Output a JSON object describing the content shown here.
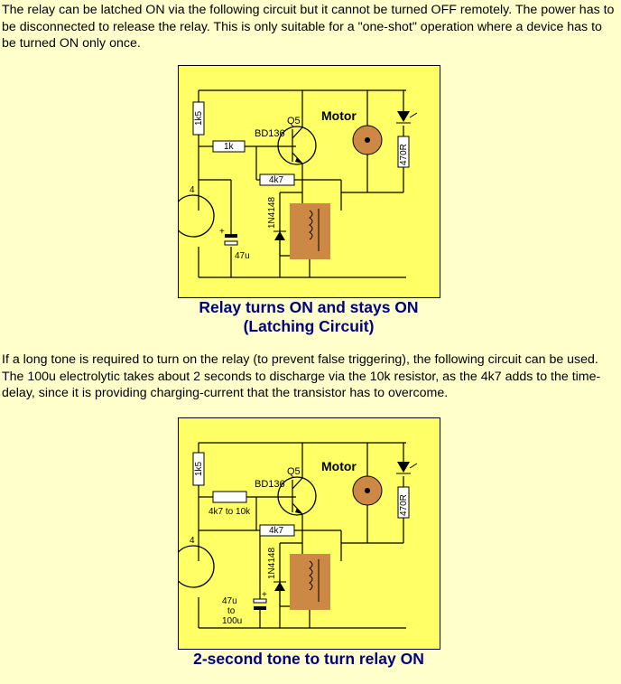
{
  "intro_text": "The relay can be latched ON via the following circuit but it cannot be turned OFF remotely. The power has to be disconnected to release the relay. This is only suitable for a \"one-shot\" operation where a device has to be turned ON only once.",
  "middle_text": "If a long tone is required to turn on the relay (to prevent false triggering), the following circuit can be used. The 100u electrolytic takes about 2 seconds to discharge via the 10k resistor, as the 4k7 adds to the time-delay, since it is providing charging-current that the transistor has to overcome.",
  "circuit1": {
    "caption_line1": "Relay turns ON and stays ON",
    "caption_line2": "(Latching Circuit)",
    "labels": {
      "r_top": "1k5",
      "r_base": "1k",
      "transistor_id": "Q5",
      "transistor_type": "BD136",
      "motor": "Motor",
      "r_led": "470R",
      "r_feedback": "4k7",
      "diode": "1N4148",
      "cap": "47u",
      "cap_plus": "+",
      "q4_fragment": "4"
    }
  },
  "circuit2": {
    "caption": "2-second tone to turn relay ON",
    "labels": {
      "r_top": "1k5",
      "r_base": "4k7 to 10k",
      "transistor_id": "Q5",
      "transistor_type": "BD136",
      "motor": "Motor",
      "r_led": "470R",
      "r_feedback": "4k7",
      "diode": "1N4148",
      "cap_line1": "47u",
      "cap_line2": "to",
      "cap_line3": "100u",
      "cap_plus": "+",
      "q4_fragment": "4"
    }
  },
  "colors": {
    "page_bg": "#ffffcc",
    "panel_bg": "#ffff66",
    "caption": "#000080",
    "motor": "#cc8844",
    "relay": "#cc8844"
  }
}
